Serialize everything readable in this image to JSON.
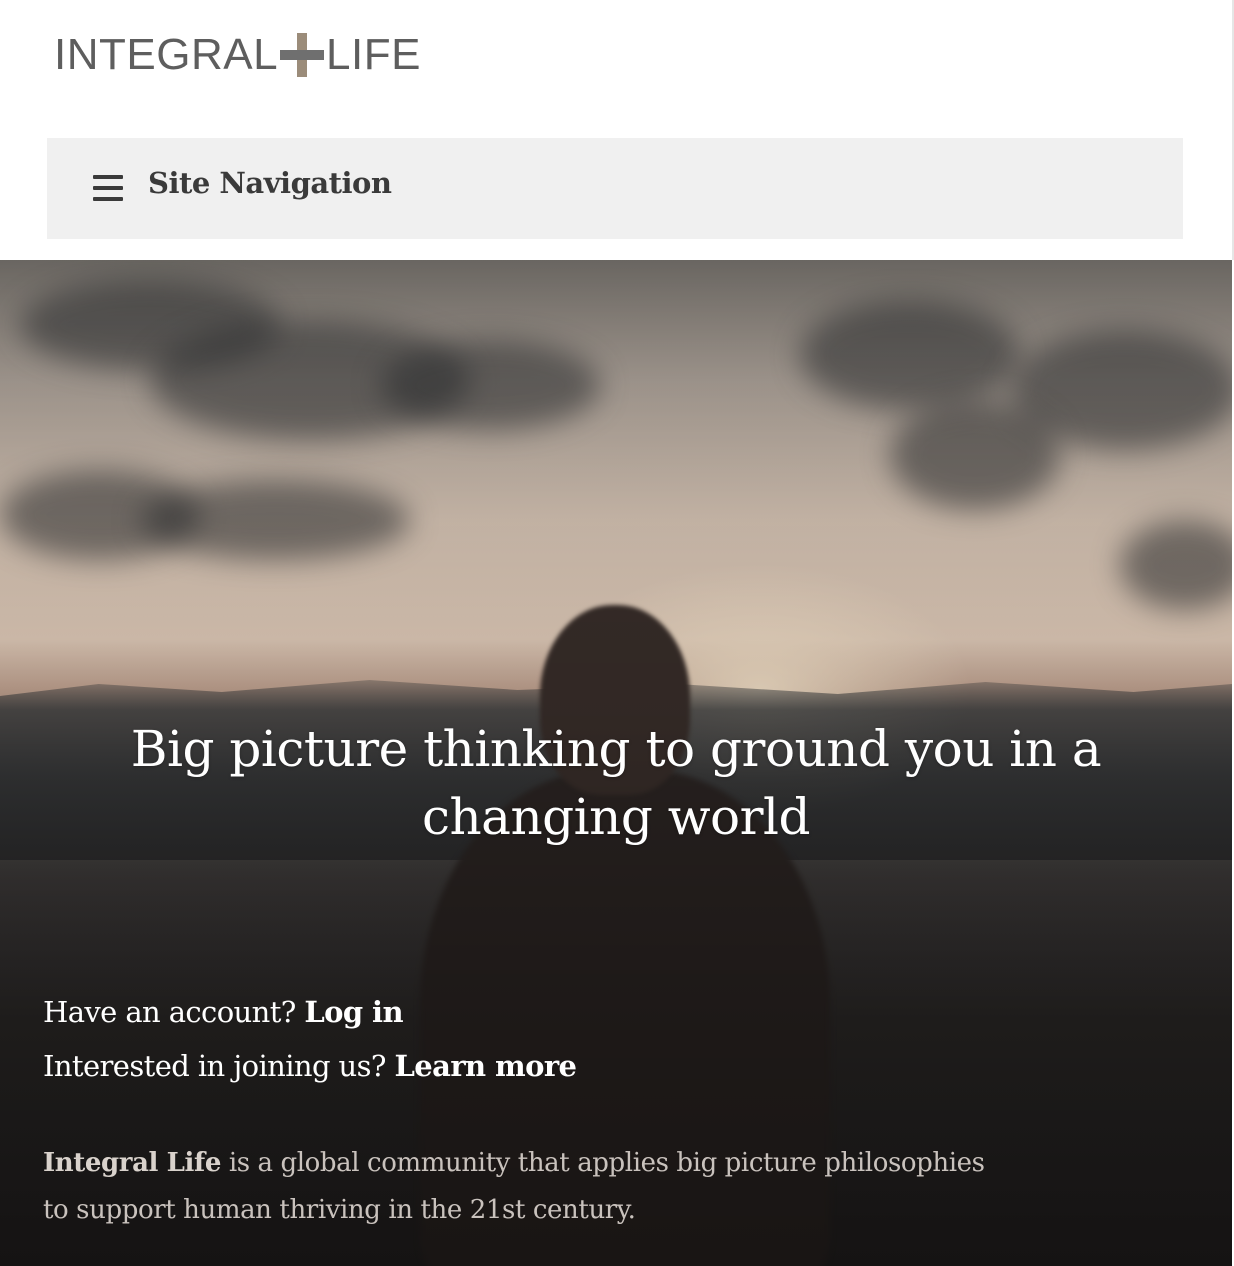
{
  "header": {
    "logo": {
      "left": "INTEGRAL",
      "right": "LIFE"
    },
    "nav": {
      "label": "Site Navigation",
      "icon": "hamburger-menu-icon"
    }
  },
  "hero": {
    "headline": "Big picture thinking to ground you in a changing world",
    "account": {
      "login_prompt": "Have an account?",
      "login_link": "Log in",
      "join_prompt": "Interested in joining us?",
      "join_link": "Learn more"
    },
    "blurb": {
      "brand": "Integral Life",
      "text_line1": " is a global community that applies big picture philosophies",
      "text_line2": "to support human thriving in the 21st century."
    }
  },
  "colors": {
    "logo_text": "#5e5e5e",
    "logo_plus_vertical": "#9b8c7a",
    "logo_plus_horizontal": "#6f6f6f",
    "nav_bar_background": "#f0f0f0",
    "hero_text": "#ffffff"
  }
}
